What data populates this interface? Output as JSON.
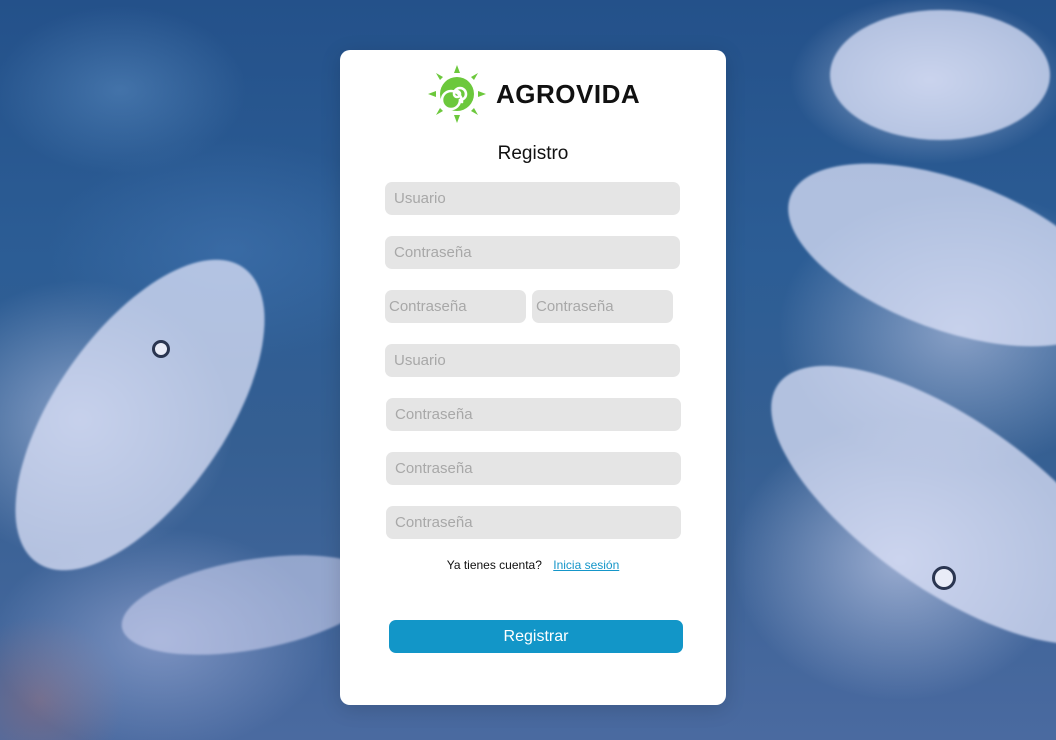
{
  "brand": {
    "name": "AGROVIDA",
    "logo_icon": "green-sun-spiral-icon",
    "logo_color": "#6cc83c"
  },
  "form": {
    "title": "Registro",
    "fields": [
      {
        "placeholder": "Usuario",
        "value": ""
      },
      {
        "placeholder": "Contraseña",
        "value": ""
      },
      {
        "placeholder": "Contraseña",
        "value": ""
      },
      {
        "placeholder": "Contraseña",
        "value": ""
      },
      {
        "placeholder": "Usuario",
        "value": ""
      },
      {
        "placeholder": "Contraseña",
        "value": ""
      },
      {
        "placeholder": "Contraseña",
        "value": ""
      },
      {
        "placeholder": "Contraseña",
        "value": ""
      }
    ],
    "signin_prompt": "Ya tienes cuenta?",
    "signin_link": "Inicia sesión",
    "submit_label": "Registrar"
  },
  "colors": {
    "accent": "#1296c8",
    "field_bg": "#e5e5e5",
    "card_bg": "#ffffff"
  }
}
